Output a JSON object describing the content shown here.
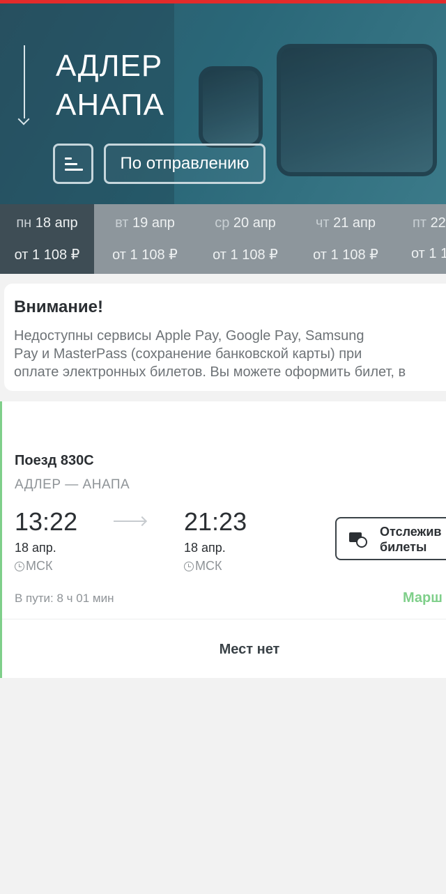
{
  "header": {
    "from_station": "АДЛЕР",
    "to_station": "АНАПА",
    "sort_button_icon": "sort-icon",
    "departure_sort_label": "По отправлению"
  },
  "dates": [
    {
      "dow": "пн",
      "date": "18 апр",
      "price": "от 1 108 ₽",
      "active": true
    },
    {
      "dow": "вт",
      "date": "19 апр",
      "price": "от 1 108 ₽",
      "active": false
    },
    {
      "dow": "ср",
      "date": "20 апр",
      "price": "от 1 108 ₽",
      "active": false
    },
    {
      "dow": "чт",
      "date": "21 апр",
      "price": "от 1 108 ₽",
      "active": false
    },
    {
      "dow": "пт",
      "date": "22",
      "price": "от 1 1",
      "active": false
    }
  ],
  "notice": {
    "title": "Внимание!",
    "lines": [
      "Недоступны сервисы Apple Pay, Google Pay, Samsung",
      "Pay и MasterPass (сохранение банковской карты) при",
      "оплате электронных билетов. Вы можете оформить билет, в"
    ]
  },
  "train": {
    "number": "Поезд 830С",
    "route": "АДЛЕР — АНАПА",
    "departure_time": "13:22",
    "departure_date": "18 апр.",
    "departure_tz": "МСК",
    "arrival_time": "21:23",
    "arrival_date": "18 апр.",
    "arrival_tz": "МСК",
    "track_button_line1": "Отслежив",
    "track_button_line2": "билеты",
    "travel_time": "В пути: 8 ч 01 мин",
    "route_link": "Марш",
    "no_seats": "Мест нет"
  },
  "colors": {
    "top_strip": "#e32b2b",
    "accent_green": "#7fcf8a",
    "active_date_bg": "#3e4d55"
  }
}
